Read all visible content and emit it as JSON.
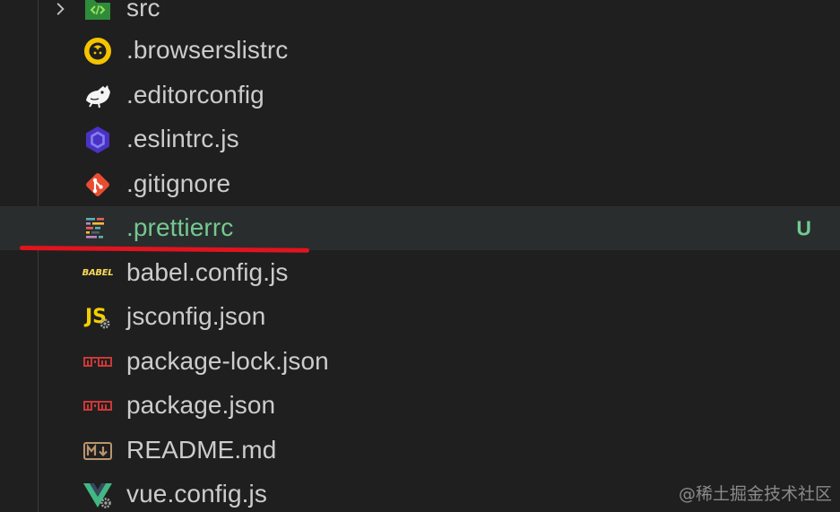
{
  "explorer": {
    "items": [
      {
        "label": "src",
        "type": "folder",
        "icon": "source-folder-icon",
        "state": "collapsed"
      },
      {
        "label": ".browserslistrc",
        "type": "file",
        "icon": "browserslist-icon"
      },
      {
        "label": ".editorconfig",
        "type": "file",
        "icon": "editorconfig-icon"
      },
      {
        "label": ".eslintrc.js",
        "type": "file",
        "icon": "eslint-icon"
      },
      {
        "label": ".gitignore",
        "type": "file",
        "icon": "git-icon"
      },
      {
        "label": ".prettierrc",
        "type": "file",
        "icon": "prettier-icon",
        "git_status": "U",
        "hovered": true
      },
      {
        "label": "babel.config.js",
        "type": "file",
        "icon": "babel-icon",
        "icon_text": "BABEL"
      },
      {
        "label": "jsconfig.json",
        "type": "file",
        "icon": "jsconfig-icon",
        "icon_text": "JS"
      },
      {
        "label": "package-lock.json",
        "type": "file",
        "icon": "npm-icon",
        "icon_text": "npm"
      },
      {
        "label": "package.json",
        "type": "file",
        "icon": "npm-icon",
        "icon_text": "npm"
      },
      {
        "label": "README.md",
        "type": "file",
        "icon": "markdown-icon"
      },
      {
        "label": "vue.config.js",
        "type": "file",
        "icon": "vue-icon"
      }
    ]
  },
  "watermark": "@稀土掘金技术社区",
  "colors": {
    "background": "#1f1f1f",
    "hover_row": "#2a2d2e",
    "text": "#cccccc",
    "untracked": "#73c991",
    "annotation": "#e0141e"
  }
}
